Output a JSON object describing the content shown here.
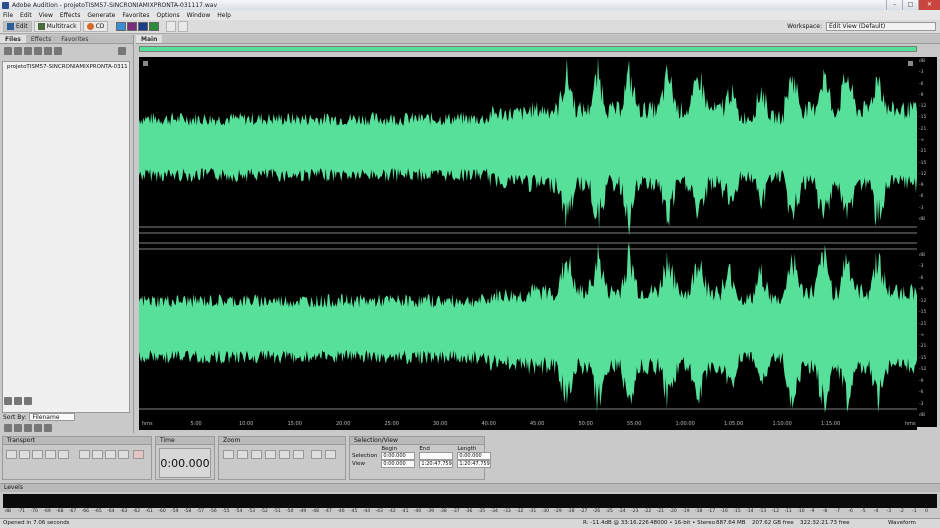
{
  "window": {
    "title": "Adobe Audition - projetoTISM57-SINCRONIAMIXPRONTA-031117.wav",
    "minimize": "–",
    "maximize": "□",
    "close": "✕"
  },
  "menu": [
    "File",
    "Edit",
    "View",
    "Effects",
    "Generate",
    "Favorites",
    "Options",
    "Window",
    "Help"
  ],
  "toolbar": {
    "edit": "Edit",
    "multitrack": "Multitrack",
    "cd": "CD",
    "workspace_label": "Workspace:",
    "workspace_value": "Edit View (Default)"
  },
  "left": {
    "tabs": [
      "Files",
      "Effects",
      "Favorites"
    ],
    "file": "projetoTISM57-SINCRONIAMIXPRONTA-0311",
    "sort_label": "Sort By:",
    "sort_value": "Filename"
  },
  "main": {
    "tab": "Main"
  },
  "ruler": [
    "hms",
    "5:00",
    "10:00",
    "15:00",
    "20:00",
    "25:00",
    "30:00",
    "40:00",
    "45:00",
    "50:00",
    "55:00",
    "1:00:00",
    "1:05:00",
    "1:10:00",
    "1:15:00",
    "hms"
  ],
  "db_top": [
    "dB",
    "-3",
    "-6",
    "-9",
    "-12",
    "-15",
    "-21",
    "-∞",
    "-21",
    "-15",
    "-12",
    "-9",
    "-6",
    "-3",
    "dB"
  ],
  "db_bottom": [
    "dB",
    "-3",
    "-6",
    "-9",
    "-12",
    "-15",
    "-21",
    "-∞",
    "-21",
    "-15",
    "-12",
    "-9",
    "-6",
    "-3",
    "dB"
  ],
  "panels": {
    "transport": "Transport",
    "time": {
      "title": "Time",
      "value": "0:00.000"
    },
    "zoom": "Zoom",
    "selection": {
      "title": "Selection/View",
      "begin": "Begin",
      "end": "End",
      "length": "Length",
      "sel_label": "Selection",
      "view_label": "View",
      "sel_begin": "0:00.000",
      "sel_end": "",
      "sel_length": "0:00.000",
      "view_begin": "0:00.000",
      "view_end": "1:20:47.759",
      "view_length": "1:20:47.759"
    }
  },
  "levels": {
    "title": "Levels",
    "ticks": [
      "dB",
      "-71",
      "-70",
      "-69",
      "-68",
      "-67",
      "-66",
      "-65",
      "-64",
      "-63",
      "-62",
      "-61",
      "-60",
      "-59",
      "-58",
      "-57",
      "-56",
      "-55",
      "-54",
      "-53",
      "-52",
      "-51",
      "-50",
      "-49",
      "-48",
      "-47",
      "-46",
      "-45",
      "-44",
      "-43",
      "-42",
      "-41",
      "-40",
      "-39",
      "-38",
      "-37",
      "-36",
      "-35",
      "-34",
      "-33",
      "-32",
      "-31",
      "-30",
      "-29",
      "-28",
      "-27",
      "-26",
      "-25",
      "-24",
      "-23",
      "-22",
      "-21",
      "-20",
      "-19",
      "-18",
      "-17",
      "-16",
      "-15",
      "-14",
      "-13",
      "-12",
      "-11",
      "-10",
      "-9",
      "-8",
      "-7",
      "-6",
      "-5",
      "-4",
      "-3",
      "-2",
      "-1",
      "0"
    ]
  },
  "status": {
    "opened": "Opened in 7.06 seconds",
    "r": "R: -11.4dB @ 33:16.226",
    "format": "48000 • 16-bit • Stereo",
    "size": "887.64 MB",
    "free": "207.62 GB free",
    "time_free": "322:32:21.73 free",
    "view": "Waveform"
  },
  "colors": {
    "waveform": "#57e09a",
    "background": "#000000"
  }
}
